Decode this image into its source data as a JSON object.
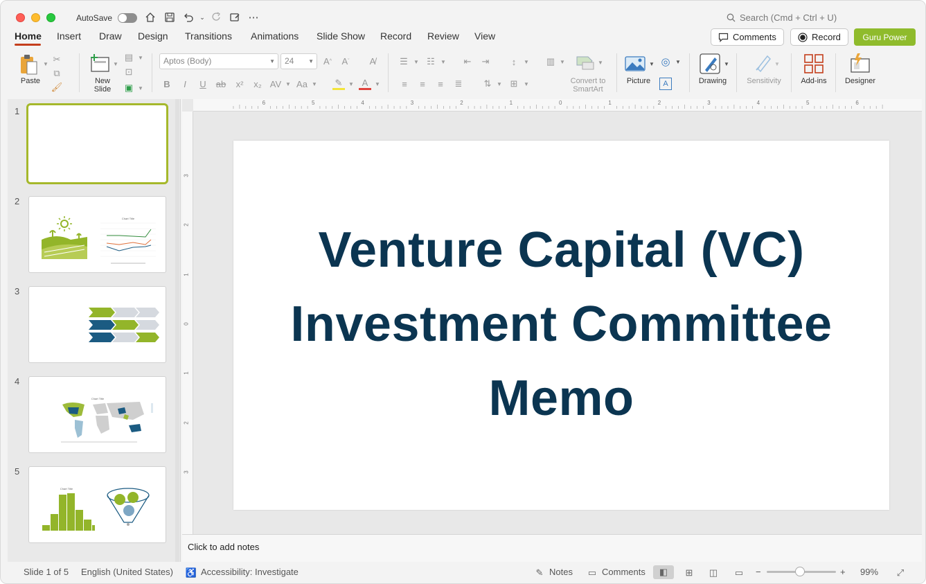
{
  "titlebar": {
    "autosave_label": "AutoSave",
    "search_placeholder": "Search (Cmd + Ctrl + U)"
  },
  "tabs": [
    {
      "label": "Home"
    },
    {
      "label": "Insert"
    },
    {
      "label": "Draw"
    },
    {
      "label": "Design"
    },
    {
      "label": "Transitions"
    },
    {
      "label": "Animations"
    },
    {
      "label": "Slide Show"
    },
    {
      "label": "Record"
    },
    {
      "label": "Review"
    },
    {
      "label": "View"
    }
  ],
  "header_buttons": {
    "comments": "Comments",
    "record": "Record",
    "guru": "Guru Power"
  },
  "ribbon": {
    "paste": "Paste",
    "new_slide": "New\nSlide",
    "font_name": "Aptos (Body)",
    "font_size": "24",
    "convert_smartart": "Convert to\nSmartArt",
    "picture": "Picture",
    "drawing": "Drawing",
    "sensitivity": "Sensitivity",
    "addins": "Add-ins",
    "designer": "Designer"
  },
  "slides_panel": {
    "numbers": [
      "1",
      "2",
      "3",
      "4",
      "5"
    ],
    "thumb2_chart_title": "Chart Title",
    "thumb4_chart_title": "Chart Title",
    "thumb5_chart_title": "Chart Title"
  },
  "ruler": {
    "h_ticks": [
      "6",
      "5",
      "4",
      "3",
      "2",
      "1",
      "0",
      "1",
      "2",
      "3",
      "4",
      "5",
      "6"
    ],
    "v_ticks": [
      "3",
      "2",
      "1",
      "0",
      "1",
      "2",
      "3"
    ]
  },
  "slide": {
    "title": "Venture Capital (VC) Investment Committee Memo"
  },
  "notes": {
    "placeholder": "Click to add notes"
  },
  "status": {
    "slide_count": "Slide 1 of 5",
    "language": "English (United States)",
    "accessibility": "Accessibility: Investigate",
    "notes": "Notes",
    "comments": "Comments",
    "zoom": "99%",
    "zoom_minus": "−",
    "zoom_plus": "+"
  },
  "colors": {
    "accent": "#c43e1c",
    "title_text": "#0b3551",
    "guru_button": "#8fbb2c",
    "selected_thumb_border": "#a5b82b"
  }
}
